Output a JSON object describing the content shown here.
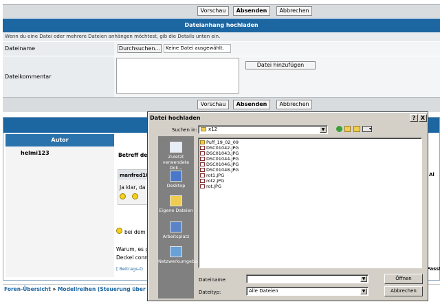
{
  "forum": {
    "buttons": {
      "preview": "Vorschau",
      "submit": "Absenden",
      "cancel": "Abbrechen"
    },
    "attachment_header": "Dateianhang hochladen",
    "attachment_hint": "Wenn du eine Datei oder mehrere Dateien anhängen möchtest, gib die Details unten ein.",
    "filename_label": "Dateiname",
    "browse_button": "Durchsuchen...",
    "no_file": "Keine Datei ausgewählt.",
    "comment_label": "Dateikommentar",
    "add_file_button": "Datei hinzufügen",
    "author_header": "Autor",
    "author_name": "helmi123",
    "subject_prefix": "Betreff des",
    "quote_author": "manfred18",
    "quote_text": "Ja klar, da",
    "post_snippet_1": "bei dem",
    "post_snippet_2": "Warum, es g",
    "post_snippet_3": "Deckel conn",
    "post_link": "[ Beitrags-D",
    "right_fragment_1": "Al",
    "right_fragment_2": "Fasst",
    "breadcrumb_home": "Foren-Übersicht",
    "breadcrumb_sep": "»",
    "breadcrumb_cat": "Modellreihen (Steuerung über \"Pe"
  },
  "dialog": {
    "title": "Datei hochladen",
    "help": "?",
    "close": "X",
    "look_in_label": "Suchen in:",
    "current_folder": "x12",
    "places": [
      {
        "name": "Zuletzt verwendete Dok...",
        "icon": "recent-documents-icon"
      },
      {
        "name": "Desktop",
        "icon": "desktop-icon"
      },
      {
        "name": "Eigene Dateien",
        "icon": "my-documents-icon"
      },
      {
        "name": "Arbeitsplatz",
        "icon": "my-computer-icon"
      },
      {
        "name": "Netzwerkumgebung",
        "icon": "network-icon"
      }
    ],
    "files": [
      {
        "name": "Puff_19_02_09",
        "type": "folder"
      },
      {
        "name": "DSC01042.JPG",
        "type": "image"
      },
      {
        "name": "DSC01043.JPG",
        "type": "image"
      },
      {
        "name": "DSC01044.JPG",
        "type": "image"
      },
      {
        "name": "DSC01046.JPG",
        "type": "image"
      },
      {
        "name": "DSC01048.JPG",
        "type": "image"
      },
      {
        "name": "rot1.JPG",
        "type": "image"
      },
      {
        "name": "rot2.JPG",
        "type": "image"
      },
      {
        "name": "rot.JPG",
        "type": "image"
      }
    ],
    "filename_label": "Dateiname:",
    "filename_value": "",
    "filetype_label": "Dateityp:",
    "filetype_value": "Alle Dateien",
    "open_button": "Öffnen",
    "cancel_button": "Abbrechen"
  },
  "colors": {
    "header_blue": "#1c66a2",
    "dialog_gray": "#d4d0c8",
    "places_gray": "#808080"
  }
}
